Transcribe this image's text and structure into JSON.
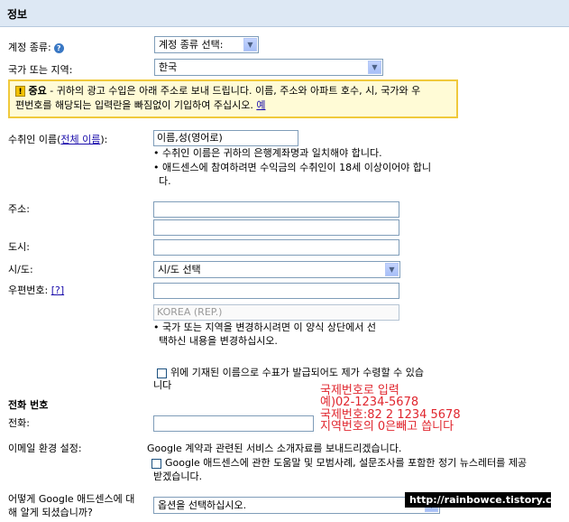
{
  "header": {
    "title": "정보"
  },
  "account_type": {
    "label": "계정 종류:",
    "select_value": "계정 종류 선택:"
  },
  "country": {
    "label": "국가 또는 지역:",
    "select_value": "한국"
  },
  "notice": {
    "title": "중요",
    "text_line1": " - 귀하의 광고 수입은 아래 주소로 보내 드립니다. 이름, 주소와 아파트 호수, 시, 국가와 우",
    "text_line2": "편번호를 해당되는 입력란을 빠짐없이 기입하여 주십시오. ",
    "link": "예"
  },
  "payee": {
    "label_prefix": "수취인 이름(",
    "label_link": "전체 이름",
    "label_suffix": "):",
    "input_value": "이름,성(영어로)",
    "note1": "• 수취인 이름은 귀하의 은행계좌명과 일치해야 합니다.",
    "note2_line1": "• 애드센스에 참여하려면 수익금의 수취인이 18세 이상이어야 합니",
    "note2_line2": "다."
  },
  "address": {
    "label": "주소:"
  },
  "city": {
    "label": "도시:"
  },
  "province": {
    "label": "시/도:",
    "select_value": "시/도 선택"
  },
  "postal": {
    "label": "우편번호:",
    "help": "[?]"
  },
  "country_field": {
    "value": "KOREA (REP.)",
    "note_line1": "• 국가 또는 지역을 변경하시려면 이 양식 상단에서 선",
    "note_line2": "택하신 내용을 변경하십시오."
  },
  "check_name": {
    "line1": "위에 기재된 이름으로 수표가 발급되어도 제가 수령할 수 있습",
    "line2": "니다"
  },
  "phone_section": {
    "title": "전화 번호",
    "label": "전화:"
  },
  "annotation": {
    "line1": "국제번호로 입력",
    "line2": "예)02-1234-5678",
    "line3": "국제번호:82 2 1234 5678",
    "line4": "지역번호의 0은빼고 씁니다"
  },
  "email": {
    "label": "이메일 환경 설정:",
    "text1": "Google 계약과 관련된 서비스 소개자료를 보내드리겠습니다.",
    "check_line1": "Google 애드센스에 관한 도움말 및 모범사례, 설문조사를 포함한 정기 뉴스레터를 제공",
    "check_line2": "받겠습니다."
  },
  "referral": {
    "label_line1": "어떻게 Google 애드센스에 대",
    "label_line2": "해 알게 되셨습니까?",
    "select_value": "옵션을 선택하십시오."
  },
  "watermark": "http://rainbowce.tistory.com"
}
